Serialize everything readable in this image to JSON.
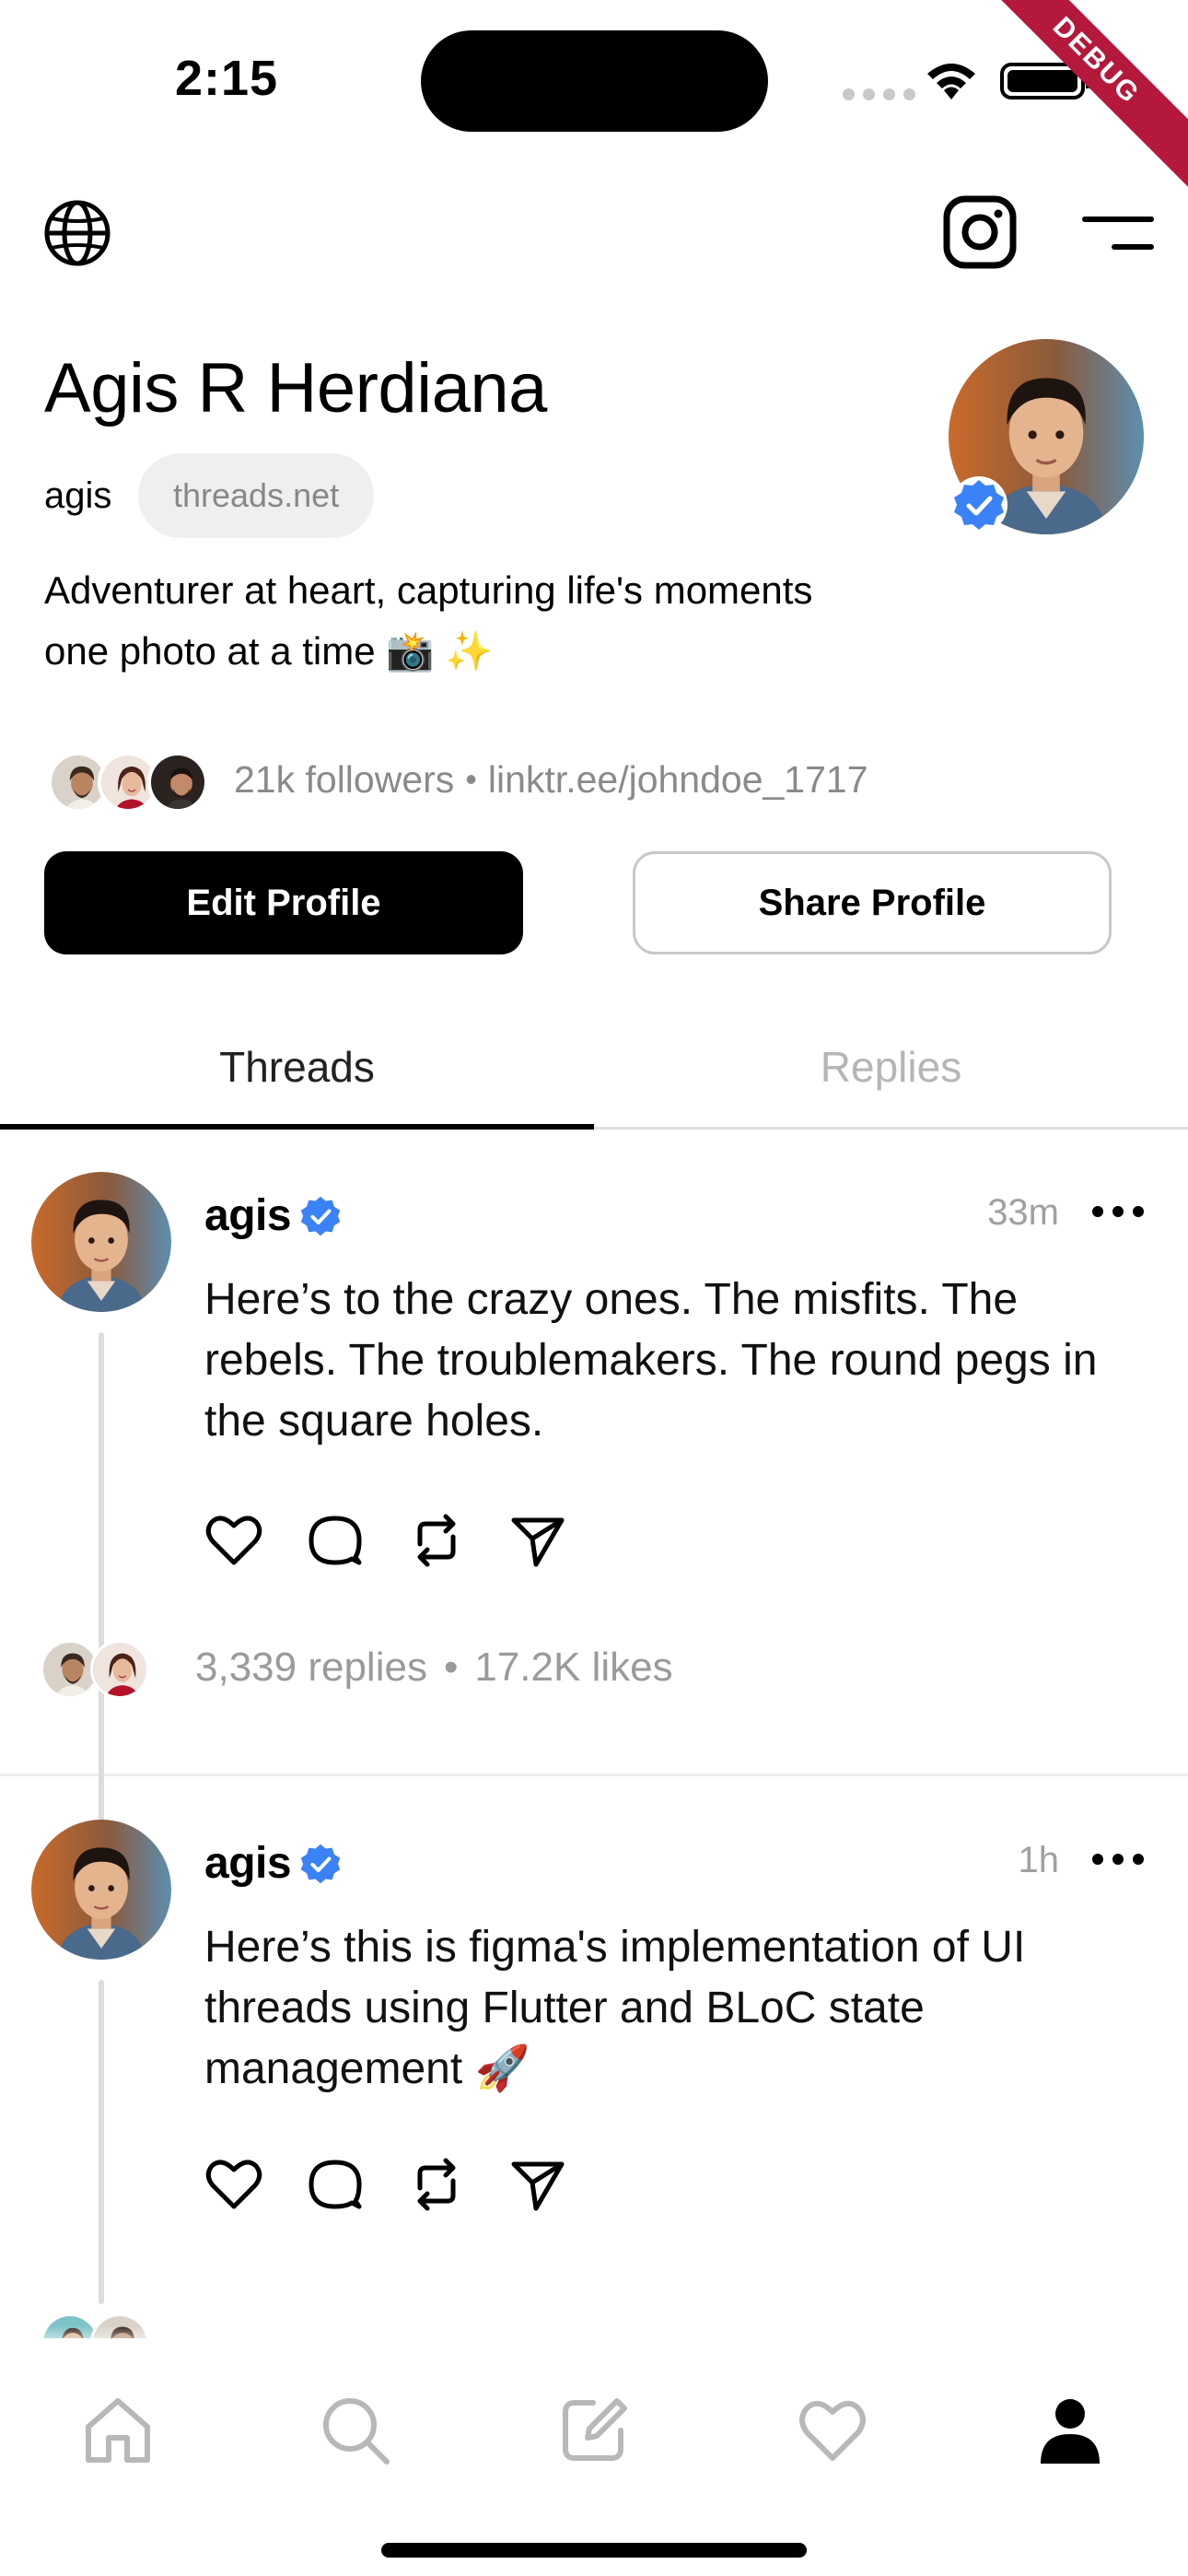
{
  "status_bar": {
    "time": "2:15",
    "debug_label": "DEBUG"
  },
  "top_nav": {
    "globe_icon": "globe-icon",
    "instagram_icon": "instagram-icon",
    "menu_icon": "menu-icon"
  },
  "profile": {
    "name": "Agis R Herdiana",
    "username": "agis",
    "domain": "threads.net",
    "bio_line_1": "Adventurer at heart, capturing life's moments",
    "bio_line_2": "one photo at a time 📸 ✨",
    "followers": "21k followers",
    "separator": "•",
    "link": "linktr.ee/johndoe_1717",
    "verified": true
  },
  "buttons": {
    "edit_profile": "Edit Profile",
    "share_profile": "Share Profile"
  },
  "tabs": [
    {
      "label": "Threads",
      "active": true
    },
    {
      "label": "Replies",
      "active": false
    }
  ],
  "posts": [
    {
      "user": "agis",
      "time": "33m",
      "text_lines": [
        "Here’s to the crazy ones. The misfits. The",
        "rebels. The troublemakers. The round pegs in",
        "the square holes."
      ],
      "replies": "3,339 replies",
      "dot": "•",
      "likes": "17.2K likes"
    },
    {
      "user": "agis",
      "time": "1h",
      "text_lines": [
        "Here’s this is figma's implementation of UI",
        "threads using Flutter and BLoC state",
        "management 🚀"
      ]
    }
  ],
  "bottom_nav": [
    "home-icon",
    "search-icon",
    "compose-icon",
    "heart-icon",
    "profile-icon"
  ],
  "colors": {
    "accent_verified": "#3b82f6",
    "muted_text": "#8a8a8a",
    "debug_ribbon": "#b4193c"
  }
}
